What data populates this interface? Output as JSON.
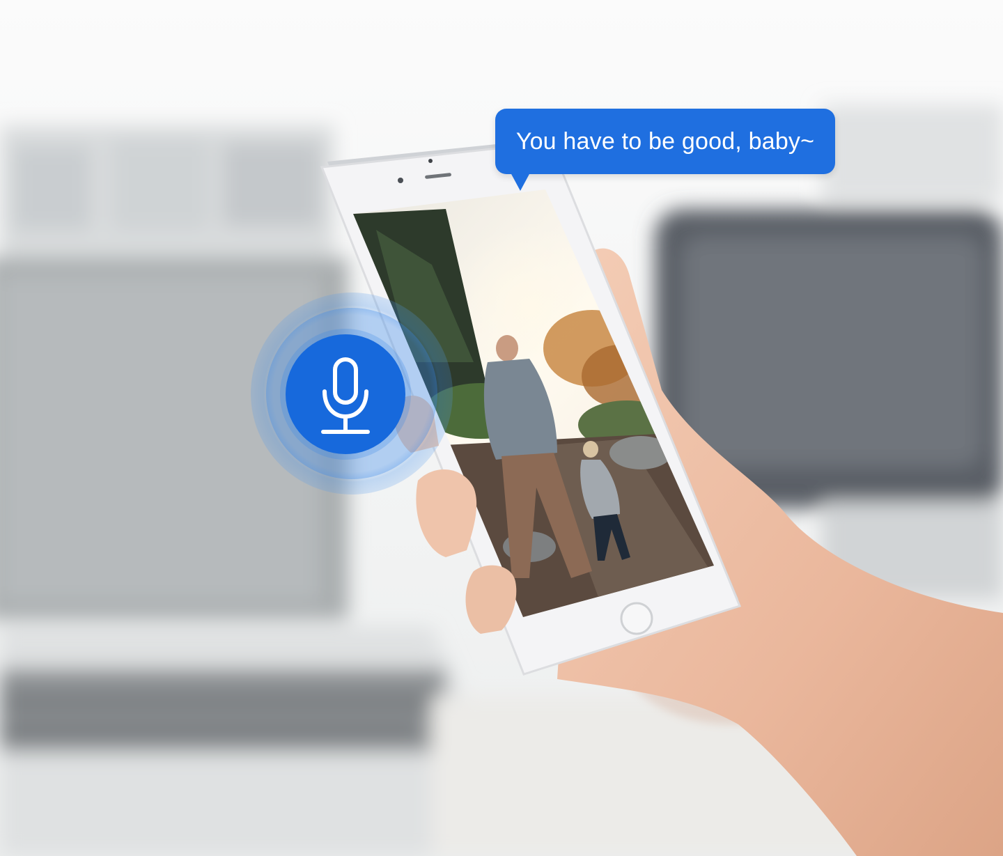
{
  "speech_bubble": {
    "text": "You have to be good, baby~"
  },
  "icons": {
    "microphone": "microphone-icon"
  },
  "colors": {
    "accent": "#1f6fe0",
    "mic_core": "#1769dc",
    "phone_body": "#f4f4f6"
  }
}
